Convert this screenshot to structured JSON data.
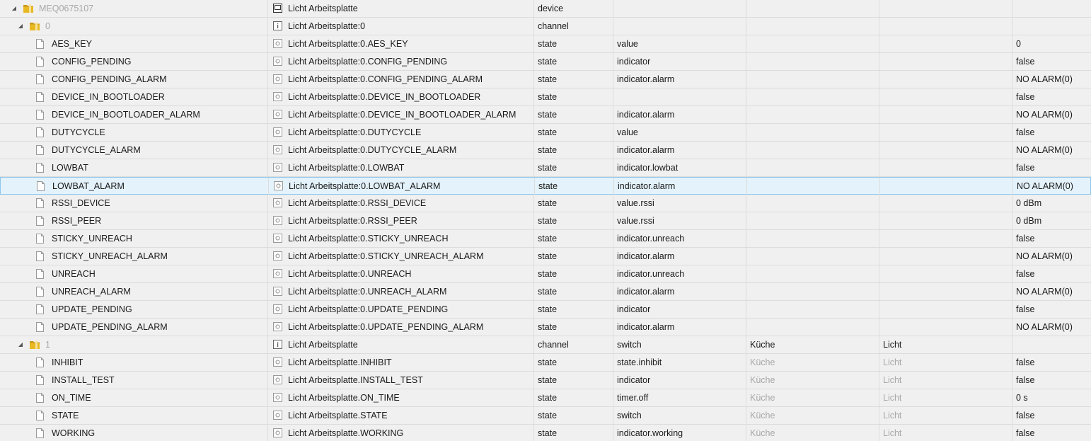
{
  "rows": [
    {
      "level": 0,
      "kind": "device",
      "expanded": true,
      "name": "MEQ0675107",
      "title": "Licht Arbeitsplatte",
      "type": "device",
      "role": "",
      "room": "",
      "function": "",
      "value": "",
      "muted_name": true
    },
    {
      "level": 1,
      "kind": "channel",
      "expanded": true,
      "name": "0",
      "title": "Licht Arbeitsplatte:0",
      "type": "channel",
      "role": "",
      "room": "",
      "function": "",
      "value": "",
      "muted_name": true
    },
    {
      "level": 2,
      "kind": "state",
      "name": "AES_KEY",
      "title": "Licht Arbeitsplatte:0.AES_KEY",
      "type": "state",
      "role": "value",
      "room": "",
      "function": "",
      "value": "0"
    },
    {
      "level": 2,
      "kind": "state",
      "name": "CONFIG_PENDING",
      "title": "Licht Arbeitsplatte:0.CONFIG_PENDING",
      "type": "state",
      "role": "indicator",
      "room": "",
      "function": "",
      "value": "false"
    },
    {
      "level": 2,
      "kind": "state",
      "name": "CONFIG_PENDING_ALARM",
      "title": "Licht Arbeitsplatte:0.CONFIG_PENDING_ALARM",
      "type": "state",
      "role": "indicator.alarm",
      "room": "",
      "function": "",
      "value": "NO ALARM(0)"
    },
    {
      "level": 2,
      "kind": "state",
      "name": "DEVICE_IN_BOOTLOADER",
      "title": "Licht Arbeitsplatte:0.DEVICE_IN_BOOTLOADER",
      "type": "state",
      "role": "",
      "room": "",
      "function": "",
      "value": "false"
    },
    {
      "level": 2,
      "kind": "state",
      "name": "DEVICE_IN_BOOTLOADER_ALARM",
      "title": "Licht Arbeitsplatte:0.DEVICE_IN_BOOTLOADER_ALARM",
      "type": "state",
      "role": "indicator.alarm",
      "room": "",
      "function": "",
      "value": "NO ALARM(0)"
    },
    {
      "level": 2,
      "kind": "state",
      "name": "DUTYCYCLE",
      "title": "Licht Arbeitsplatte:0.DUTYCYCLE",
      "type": "state",
      "role": "value",
      "room": "",
      "function": "",
      "value": "false"
    },
    {
      "level": 2,
      "kind": "state",
      "name": "DUTYCYCLE_ALARM",
      "title": "Licht Arbeitsplatte:0.DUTYCYCLE_ALARM",
      "type": "state",
      "role": "indicator.alarm",
      "room": "",
      "function": "",
      "value": "NO ALARM(0)"
    },
    {
      "level": 2,
      "kind": "state",
      "name": "LOWBAT",
      "title": "Licht Arbeitsplatte:0.LOWBAT",
      "type": "state",
      "role": "indicator.lowbat",
      "room": "",
      "function": "",
      "value": "false"
    },
    {
      "level": 2,
      "kind": "state",
      "name": "LOWBAT_ALARM",
      "title": "Licht Arbeitsplatte:0.LOWBAT_ALARM",
      "type": "state",
      "role": "indicator.alarm",
      "room": "",
      "function": "",
      "value": "NO ALARM(0)",
      "selected": true
    },
    {
      "level": 2,
      "kind": "state",
      "name": "RSSI_DEVICE",
      "title": "Licht Arbeitsplatte:0.RSSI_DEVICE",
      "type": "state",
      "role": "value.rssi",
      "room": "",
      "function": "",
      "value": "0 dBm"
    },
    {
      "level": 2,
      "kind": "state",
      "name": "RSSI_PEER",
      "title": "Licht Arbeitsplatte:0.RSSI_PEER",
      "type": "state",
      "role": "value.rssi",
      "room": "",
      "function": "",
      "value": "0 dBm"
    },
    {
      "level": 2,
      "kind": "state",
      "name": "STICKY_UNREACH",
      "title": "Licht Arbeitsplatte:0.STICKY_UNREACH",
      "type": "state",
      "role": "indicator.unreach",
      "room": "",
      "function": "",
      "value": "false"
    },
    {
      "level": 2,
      "kind": "state",
      "name": "STICKY_UNREACH_ALARM",
      "title": "Licht Arbeitsplatte:0.STICKY_UNREACH_ALARM",
      "type": "state",
      "role": "indicator.alarm",
      "room": "",
      "function": "",
      "value": "NO ALARM(0)"
    },
    {
      "level": 2,
      "kind": "state",
      "name": "UNREACH",
      "title": "Licht Arbeitsplatte:0.UNREACH",
      "type": "state",
      "role": "indicator.unreach",
      "room": "",
      "function": "",
      "value": "false"
    },
    {
      "level": 2,
      "kind": "state",
      "name": "UNREACH_ALARM",
      "title": "Licht Arbeitsplatte:0.UNREACH_ALARM",
      "type": "state",
      "role": "indicator.alarm",
      "room": "",
      "function": "",
      "value": "NO ALARM(0)"
    },
    {
      "level": 2,
      "kind": "state",
      "name": "UPDATE_PENDING",
      "title": "Licht Arbeitsplatte:0.UPDATE_PENDING",
      "type": "state",
      "role": "indicator",
      "room": "",
      "function": "",
      "value": "false"
    },
    {
      "level": 2,
      "kind": "state",
      "name": "UPDATE_PENDING_ALARM",
      "title": "Licht Arbeitsplatte:0.UPDATE_PENDING_ALARM",
      "type": "state",
      "role": "indicator.alarm",
      "room": "",
      "function": "",
      "value": "NO ALARM(0)"
    },
    {
      "level": 1,
      "kind": "channel",
      "expanded": true,
      "name": "1",
      "title": "Licht Arbeitsplatte",
      "type": "channel",
      "role": "switch",
      "room": "Küche",
      "function": "Licht",
      "value": "",
      "muted_name": true
    },
    {
      "level": 2,
      "kind": "state",
      "name": "INHIBIT",
      "title": "Licht Arbeitsplatte.INHIBIT",
      "type": "state",
      "role": "state.inhibit",
      "room": "Küche",
      "function": "Licht",
      "value": "false",
      "muted_enum": true
    },
    {
      "level": 2,
      "kind": "state",
      "name": "INSTALL_TEST",
      "title": "Licht Arbeitsplatte.INSTALL_TEST",
      "type": "state",
      "role": "indicator",
      "room": "Küche",
      "function": "Licht",
      "value": "false",
      "muted_enum": true
    },
    {
      "level": 2,
      "kind": "state",
      "name": "ON_TIME",
      "title": "Licht Arbeitsplatte.ON_TIME",
      "type": "state",
      "role": "timer.off",
      "room": "Küche",
      "function": "Licht",
      "value": "0 s",
      "muted_enum": true
    },
    {
      "level": 2,
      "kind": "state",
      "name": "STATE",
      "title": "Licht Arbeitsplatte.STATE",
      "type": "state",
      "role": "switch",
      "room": "Küche",
      "function": "Licht",
      "value": "false",
      "muted_enum": true
    },
    {
      "level": 2,
      "kind": "state",
      "name": "WORKING",
      "title": "Licht Arbeitsplatte.WORKING",
      "type": "state",
      "role": "indicator.working",
      "room": "Küche",
      "function": "Licht",
      "value": "false",
      "muted_enum": true
    }
  ],
  "colors": {
    "folder": "#e8b923",
    "folder_dark": "#c9971a",
    "selected_bg": "#e4f2fb",
    "selected_border": "#8ec7ec",
    "muted_text": "#a8a8a8"
  },
  "icons": {
    "device": "device-window-icon",
    "channel": "channel-info-icon",
    "state": "state-circle-icon",
    "folder": "folder-icon",
    "file": "file-icon",
    "expand": "expanded-triangle-icon"
  }
}
